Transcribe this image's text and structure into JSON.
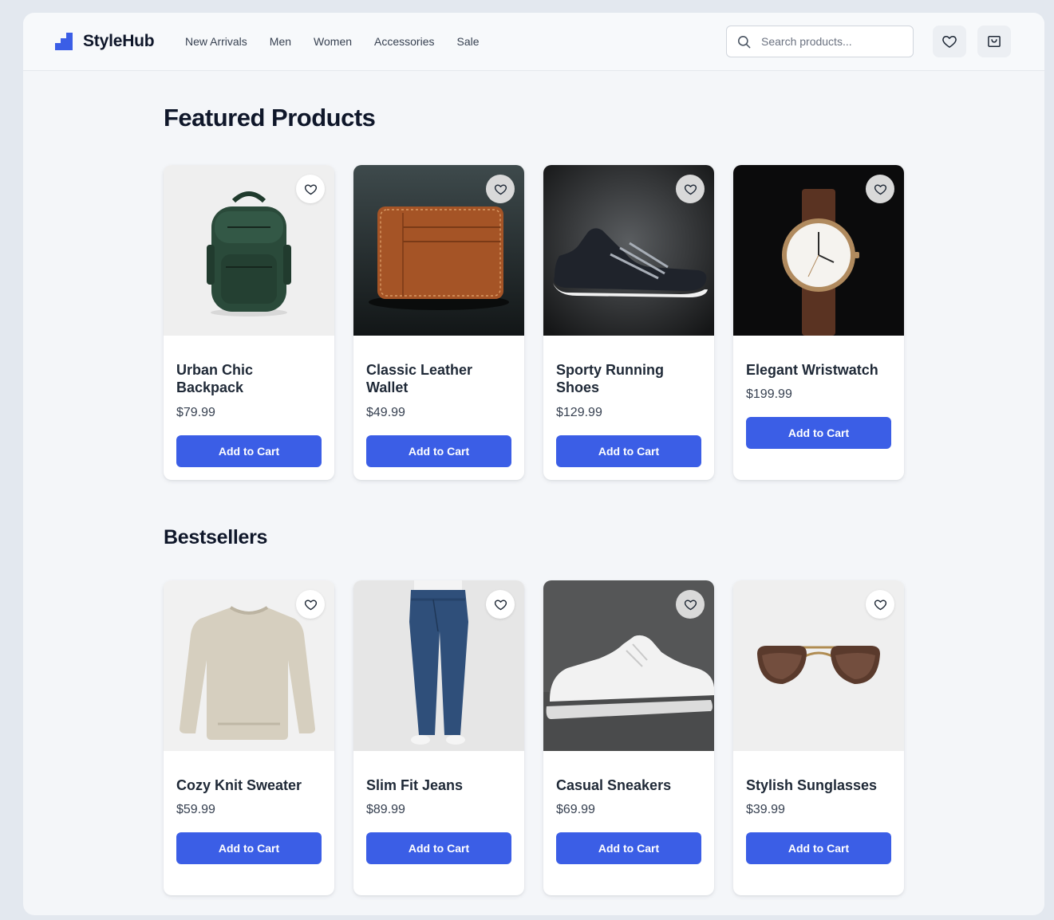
{
  "header": {
    "brand": "StyleHub",
    "nav": [
      "New Arrivals",
      "Men",
      "Women",
      "Accessories",
      "Sale"
    ],
    "search_placeholder": "Search products...",
    "accent": "#3b5ee6"
  },
  "sections": {
    "featured": {
      "title": "Featured Products",
      "products": [
        {
          "name": "Urban Chic Backpack",
          "price": "$79.99",
          "button": "Add to Cart",
          "image": "backpack"
        },
        {
          "name": "Classic Leather Wallet",
          "price": "$49.99",
          "button": "Add to Cart",
          "image": "wallet"
        },
        {
          "name": "Sporty Running Shoes",
          "price": "$129.99",
          "button": "Add to Cart",
          "image": "running-shoe"
        },
        {
          "name": "Elegant Wristwatch",
          "price": "$199.99",
          "button": "Add to Cart",
          "image": "wristwatch"
        }
      ]
    },
    "bestsellers": {
      "title": "Bestsellers",
      "products": [
        {
          "name": "Cozy Knit Sweater",
          "price": "$59.99",
          "button": "Add to Cart",
          "image": "sweater"
        },
        {
          "name": "Slim Fit Jeans",
          "price": "$89.99",
          "button": "Add to Cart",
          "image": "jeans"
        },
        {
          "name": "Casual Sneakers",
          "price": "$69.99",
          "button": "Add to Cart",
          "image": "sneaker"
        },
        {
          "name": "Stylish Sunglasses",
          "price": "$39.99",
          "button": "Add to Cart",
          "image": "sunglasses"
        }
      ]
    }
  }
}
